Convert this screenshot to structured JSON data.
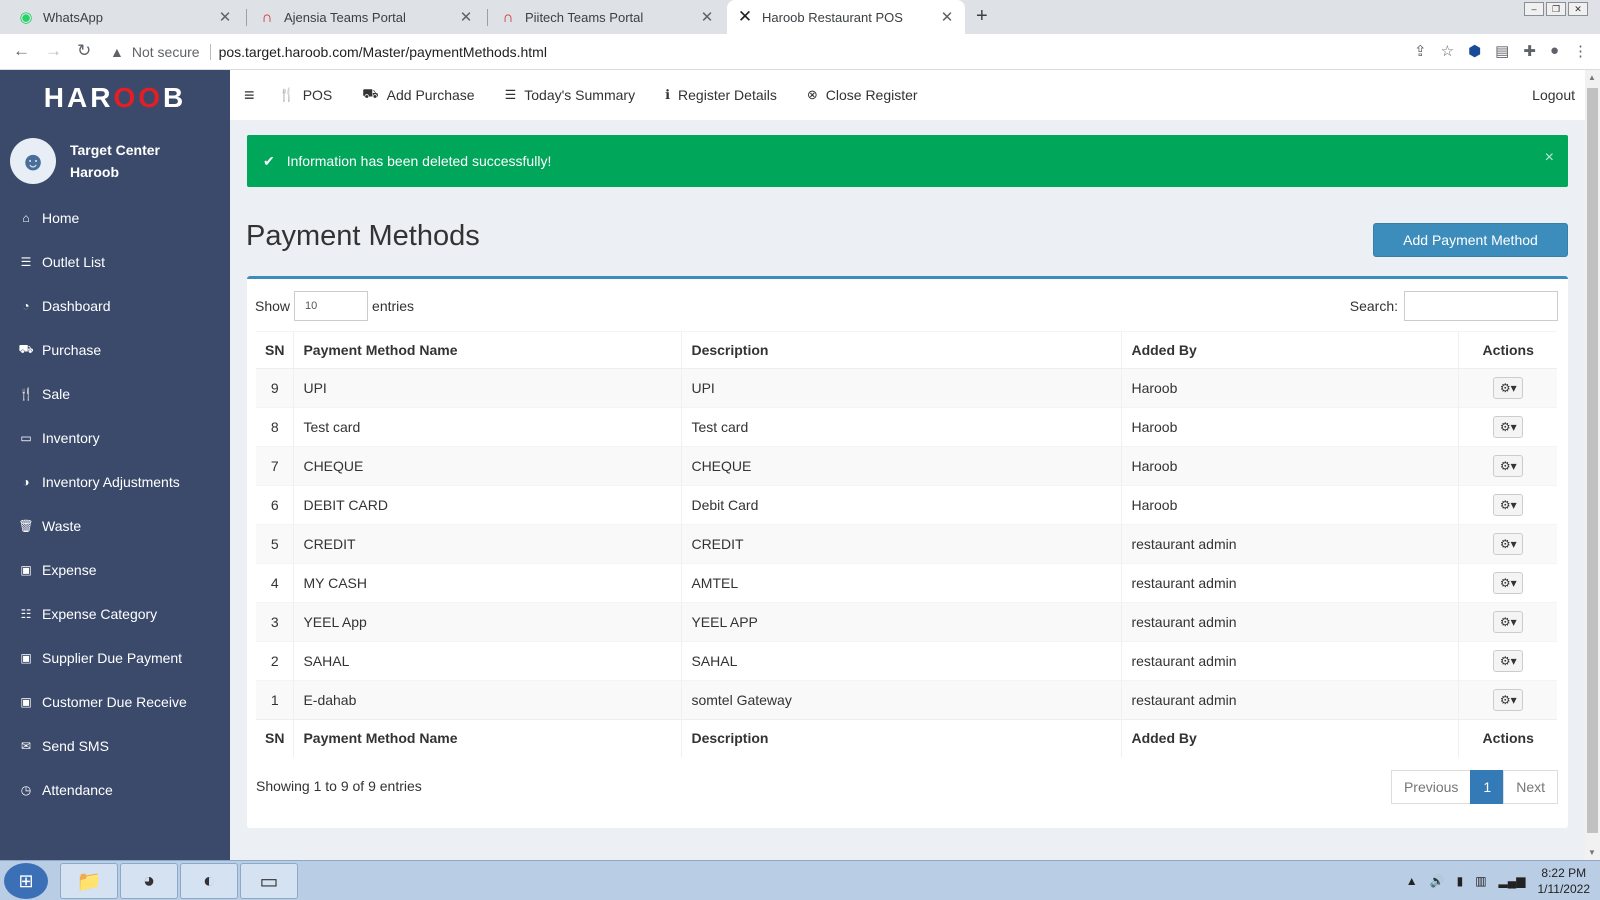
{
  "browser": {
    "tabs": [
      {
        "title": "WhatsApp",
        "icon": "whatsapp-icon",
        "icon_glyph": "◉",
        "color": "#25d366"
      },
      {
        "title": "Ajensia Teams Portal",
        "icon": "teams-portal-icon",
        "icon_glyph": "∩",
        "color": "#cc2b2b"
      },
      {
        "title": "Piitech Teams Portal",
        "icon": "teams-portal-icon",
        "icon_glyph": "∩",
        "color": "#cc2b2b"
      },
      {
        "title": "Haroob Restaurant POS",
        "icon": "haroob-icon",
        "icon_glyph": "✕",
        "color": "#202124"
      }
    ],
    "new_tab": "+",
    "security_label": "Not secure",
    "url": "pos.target.haroob.com/Master/paymentMethods.html"
  },
  "sidebar": {
    "logo_prefix": "HAR",
    "logo_mid": "OO",
    "logo_suffix": "B",
    "user_line1": "Target Center",
    "user_line2": "Haroob",
    "items": [
      {
        "label": "Home",
        "icon": "home-icon",
        "glyph": "⌂"
      },
      {
        "label": "Outlet List",
        "icon": "list-icon",
        "glyph": "☰"
      },
      {
        "label": "Dashboard",
        "icon": "dashboard-icon",
        "glyph": "◔"
      },
      {
        "label": "Purchase",
        "icon": "truck-icon",
        "glyph": "⛟"
      },
      {
        "label": "Sale",
        "icon": "cutlery-icon",
        "glyph": "🍴"
      },
      {
        "label": "Inventory",
        "icon": "inventory-icon",
        "glyph": "▭"
      },
      {
        "label": "Inventory Adjustments",
        "icon": "adjust-icon",
        "glyph": "◑"
      },
      {
        "label": "Waste",
        "icon": "trash-icon",
        "glyph": "🗑"
      },
      {
        "label": "Expense",
        "icon": "money-icon",
        "glyph": "▣"
      },
      {
        "label": "Expense Category",
        "icon": "list-alt-icon",
        "glyph": "☷"
      },
      {
        "label": "Supplier Due Payment",
        "icon": "money-icon",
        "glyph": "▣"
      },
      {
        "label": "Customer Due Receive",
        "icon": "money-icon",
        "glyph": "▣"
      },
      {
        "label": "Send SMS",
        "icon": "envelope-icon",
        "glyph": "✉"
      },
      {
        "label": "Attendance",
        "icon": "clock-icon",
        "glyph": "◷"
      }
    ]
  },
  "topnav": {
    "items": [
      {
        "label": "POS",
        "icon": "cutlery-icon",
        "glyph": "🍴"
      },
      {
        "label": "Add Purchase",
        "icon": "truck-icon",
        "glyph": "⛟"
      },
      {
        "label": "Today's Summary",
        "icon": "list-icon",
        "glyph": "☰"
      },
      {
        "label": "Register Details",
        "icon": "info-icon",
        "glyph": "ℹ"
      },
      {
        "label": "Close Register",
        "icon": "close-circle-icon",
        "glyph": "⊗"
      }
    ],
    "logout": "Logout"
  },
  "alert": {
    "message": "Information has been deleted successfully!",
    "close": "×",
    "color": "#00a65a"
  },
  "page": {
    "title": "Payment Methods",
    "add_button": "Add Payment Method"
  },
  "table": {
    "show_label": "Show",
    "show_value": "10",
    "entries_label": "entries",
    "search_label": "Search:",
    "columns": [
      "SN",
      "Payment Method Name",
      "Description",
      "Added By",
      "Actions"
    ],
    "rows": [
      {
        "sn": "9",
        "name": "UPI",
        "desc": "UPI",
        "added_by": "Haroob"
      },
      {
        "sn": "8",
        "name": "Test card",
        "desc": "Test card",
        "added_by": "Haroob"
      },
      {
        "sn": "7",
        "name": "CHEQUE",
        "desc": "CHEQUE",
        "added_by": "Haroob"
      },
      {
        "sn": "6",
        "name": "DEBIT CARD",
        "desc": "Debit Card",
        "added_by": "Haroob"
      },
      {
        "sn": "5",
        "name": "CREDIT",
        "desc": "CREDIT",
        "added_by": "restaurant admin"
      },
      {
        "sn": "4",
        "name": "MY CASH",
        "desc": "AMTEL",
        "added_by": "restaurant admin"
      },
      {
        "sn": "3",
        "name": "YEEL App",
        "desc": "YEEL APP",
        "added_by": "restaurant admin"
      },
      {
        "sn": "2",
        "name": "SAHAL",
        "desc": "SAHAL",
        "added_by": "restaurant admin"
      },
      {
        "sn": "1",
        "name": "E-dahab",
        "desc": "somtel Gateway",
        "added_by": "restaurant admin"
      }
    ],
    "info": "Showing 1 to 9 of 9 entries",
    "prev": "Previous",
    "page": "1",
    "next": "Next"
  },
  "taskbar": {
    "time": "8:22 PM",
    "date": "1/11/2022"
  }
}
